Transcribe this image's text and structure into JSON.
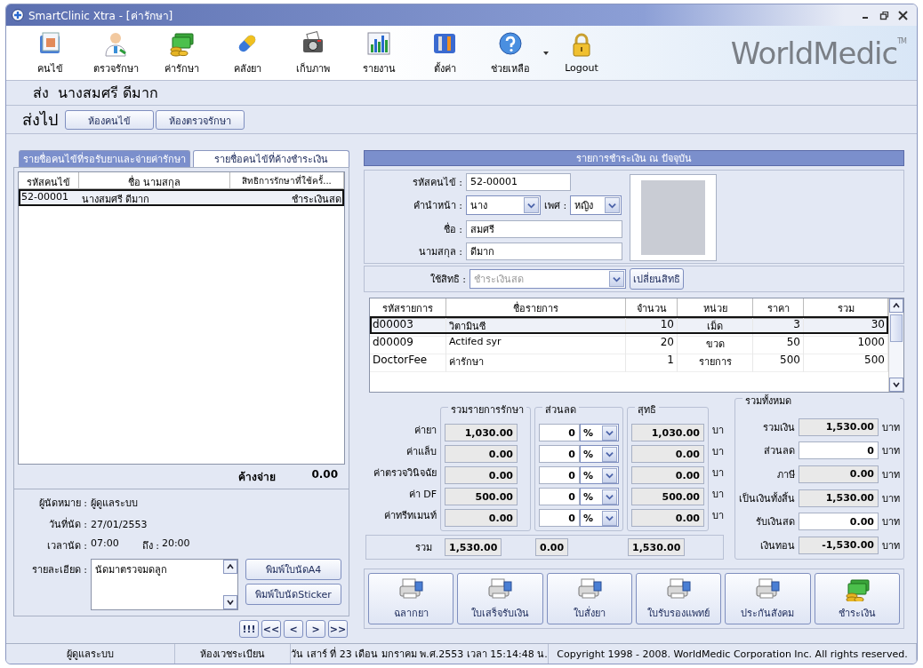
{
  "window": {
    "title": "SmartClinic Xtra - [ค่ารักษา]"
  },
  "toolbar": {
    "items": [
      {
        "label": "คนไข้",
        "kind": "folder",
        "has_menu": false
      },
      {
        "label": "ตรวจรักษา",
        "kind": "doctor",
        "has_menu": false
      },
      {
        "label": "ค่ารักษา",
        "kind": "money",
        "has_menu": false
      },
      {
        "label": "คลังยา",
        "kind": "pill",
        "has_menu": false
      },
      {
        "label": "เก็บภาพ",
        "kind": "camera",
        "has_menu": false
      },
      {
        "label": "รายงาน",
        "kind": "chart",
        "has_menu": false
      },
      {
        "label": "ตั้งค่า",
        "kind": "tools",
        "has_menu": false
      },
      {
        "label": "ช่วยเหลือ",
        "kind": "help",
        "has_menu": true
      },
      {
        "label": "Logout",
        "kind": "lock",
        "has_menu": false
      }
    ],
    "brand": "WorldMedic",
    "brand_mark": "TM"
  },
  "patient_header": {
    "title": "ส่ง  นางสมศรี ดีมาก"
  },
  "send_to": {
    "label": "ส่งไป",
    "buttons": [
      "ห้องคนไข้",
      "ห้องตรวจรักษา"
    ]
  },
  "queue_panel": {
    "tabs": [
      {
        "label": "รายชื่อคนไข้ที่รอรับยาและจ่ายค่ารักษา",
        "selected": true
      },
      {
        "label": "รายชื่อคนไข้ที่ค้างชำระเงิน",
        "selected": false
      }
    ],
    "table": {
      "columns": [
        "รหัสคนไข้",
        "ชื่อ นามสกุล",
        "สิทธิการรักษาที่ใช้ครั้..."
      ],
      "rows": [
        {
          "cells": [
            "52-00001",
            "นางสมศรี ดีมาก",
            "ชำระเงินสด"
          ],
          "selected": true
        }
      ]
    },
    "outstanding": {
      "label": "ค้างจ่าย",
      "value": "0.00"
    },
    "appointment": {
      "fields": [
        {
          "label": "ผู้นัดหมาย :",
          "value": "ผู้ดูแลระบบ"
        },
        {
          "label": "วันที่นัด :",
          "value": "27/01/2553"
        }
      ],
      "time": {
        "label": "เวลานัด :",
        "from": "07:00",
        "to_label": "ถึง :",
        "to": "20:00"
      },
      "detail": {
        "label": "รายละเอียด :",
        "value": "นัดมาตรวจมดลูก"
      },
      "buttons": [
        "พิมพ์ใบนัดA4",
        "พิมพ์ใบนัดSticker"
      ]
    },
    "nav_buttons": [
      "!!!",
      "<<",
      "<",
      ">",
      ">>"
    ]
  },
  "payment": {
    "title": "รายการชำระเงิน ณ ปัจจุบัน",
    "patient_code": {
      "label": "รหัสคนไข้ :",
      "value": "52-00001"
    },
    "prefix": {
      "label": "คำนำหน้า :",
      "value": "นาง"
    },
    "sex": {
      "label": "เพศ :",
      "value": "หญิง"
    },
    "first_name": {
      "label": "ชื่อ :",
      "value": "สมศรี"
    },
    "last_name": {
      "label": "นามสกุล :",
      "value": "ดีมาก"
    },
    "coverage": {
      "label": "ใช้สิทธิ :",
      "value": "ชำระเงินสด",
      "disabled": true
    },
    "change_coverage_button": "เปลี่ยนสิทธิ",
    "items_table": {
      "columns": [
        "รหัสรายการ",
        "ชื่อรายการ",
        "จำนวน",
        "หน่วย",
        "ราคา",
        "รวม"
      ],
      "rows": [
        {
          "cells": [
            "d00003",
            "วิตามินซี",
            "10",
            "เม็ด",
            "3",
            "30"
          ],
          "selected": true
        },
        {
          "cells": [
            "d00009",
            "Actifed syr",
            "20",
            "ขวด",
            "50",
            "1000"
          ],
          "selected": false
        },
        {
          "cells": [
            "DoctorFee",
            "ค่ารักษา",
            "1",
            "รายการ",
            "500",
            "500"
          ],
          "selected": false
        }
      ]
    },
    "summary": {
      "group_titles": [
        "รวมรายการรักษา",
        "ส่วนลด",
        "สุทธิ"
      ],
      "rows": [
        {
          "label": "ค่ายา",
          "total": "1,030.00",
          "discount": "0",
          "discount_unit": "%",
          "net": "1,030.00",
          "unit": "บา"
        },
        {
          "label": "ค่าแล็บ",
          "total": "0.00",
          "discount": "0",
          "discount_unit": "%",
          "net": "0.00",
          "unit": "บา"
        },
        {
          "label": "ค่าตรวจวินิจฉัย",
          "total": "0.00",
          "discount": "0",
          "discount_unit": "%",
          "net": "0.00",
          "unit": "บา"
        },
        {
          "label": "ค่า DF",
          "total": "500.00",
          "discount": "0",
          "discount_unit": "%",
          "net": "500.00",
          "unit": "บา"
        },
        {
          "label": "ค่าทรีทเมนท์",
          "total": "0.00",
          "discount": "0",
          "discount_unit": "%",
          "net": "0.00",
          "unit": "บา"
        }
      ],
      "totals": {
        "label": "รวม",
        "total": "1,530.00",
        "discount": "0.00",
        "net": "1,530.00"
      },
      "grand": {
        "title": "รวมทั้งหมด",
        "rows": [
          {
            "label": "รวมเงิน",
            "value": "1,530.00",
            "unit": "บาท",
            "editable": false
          },
          {
            "label": "ส่วนลด",
            "value": "0",
            "unit": "บาท",
            "editable": true
          },
          {
            "label": "ภาษี",
            "value": "0.00",
            "unit": "บาท",
            "editable": false
          },
          {
            "label": "เป็นเงินทั้งสิ้น",
            "value": "1,530.00",
            "unit": "บาท",
            "editable": false
          },
          {
            "label": "รับเงินสด",
            "value": "0.00",
            "unit": "บาท",
            "editable": true
          },
          {
            "label": "เงินทอน",
            "value": "-1,530.00",
            "unit": "บาท",
            "editable": false
          }
        ]
      }
    },
    "actions": [
      {
        "label": "ฉลากยา",
        "kind": "printer"
      },
      {
        "label": "ใบเสร็จรับเงิน",
        "kind": "printer"
      },
      {
        "label": "ใบสั่งยา",
        "kind": "printer"
      },
      {
        "label": "ใบรับรองแพทย์",
        "kind": "printer"
      },
      {
        "label": "ประกันสังคม",
        "kind": "printer"
      },
      {
        "label": "ชำระเงิน",
        "kind": "money"
      }
    ]
  },
  "status_bar": [
    "ผู้ดูแลระบบ",
    "ห้องเวชระเบียน",
    "วัน เสาร์ ที่ 23 เดือน มกราคม พ.ศ.2553 เวลา 15:14:48 น.",
    "Copyright 1998 - 2008. WorldMedic Corporation Inc. All rights reserved."
  ]
}
